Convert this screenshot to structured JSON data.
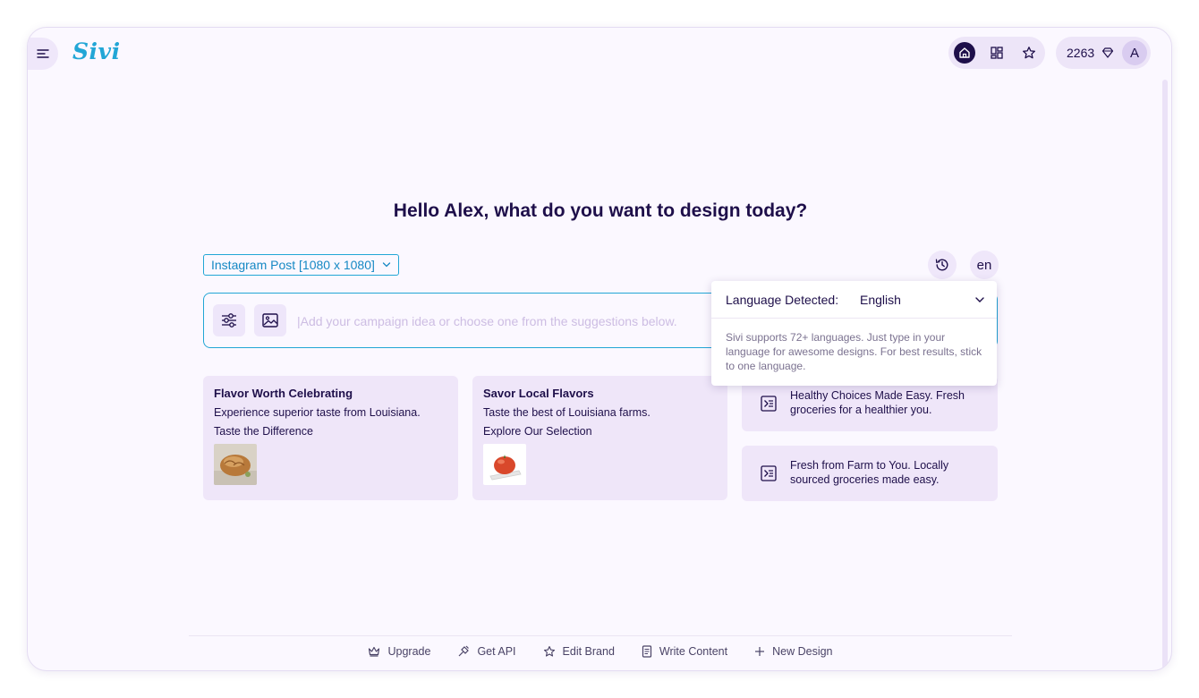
{
  "header": {
    "logo_text": "Sivi",
    "credits": "2263",
    "avatar_initial": "A"
  },
  "main": {
    "headline": "Hello Alex, what do you want to design today?",
    "format_select": "Instagram Post [1080 x 1080]",
    "language_code": "en",
    "prompt_placeholder": "|Add your campaign idea or choose one from the suggestions below."
  },
  "cards": [
    {
      "title": "Flavor Worth Celebrating",
      "line1": "Experience superior taste from Louisiana.",
      "line2": "Taste the Difference",
      "thumb": "bread-image"
    },
    {
      "title": "Savor Local Flavors",
      "line1": "Taste the best of Louisiana farms.",
      "line2": "Explore Our Selection",
      "thumb": "tomato-image"
    }
  ],
  "suggestions": [
    {
      "text": "Healthy Choices Made Easy. Fresh groceries for a healthier you."
    },
    {
      "text": "Fresh from Farm to You. Locally sourced groceries made easy."
    }
  ],
  "language_popup": {
    "label": "Language Detected:",
    "value": "English",
    "description": "Sivi supports 72+ languages. Just type in your language for awesome designs. For best results, stick to one language."
  },
  "footer": {
    "items": [
      {
        "label": "Upgrade",
        "icon": "crown-icon"
      },
      {
        "label": "Get API",
        "icon": "plug-icon"
      },
      {
        "label": "Edit Brand",
        "icon": "star-icon"
      },
      {
        "label": "Write Content",
        "icon": "document-icon"
      },
      {
        "label": "New Design",
        "icon": "plus-icon"
      }
    ]
  },
  "colors": {
    "accent": "#22a6d6",
    "text": "#1e0f4a",
    "card_bg": "#efe6f9",
    "page_bg": "#fbf8ff"
  }
}
